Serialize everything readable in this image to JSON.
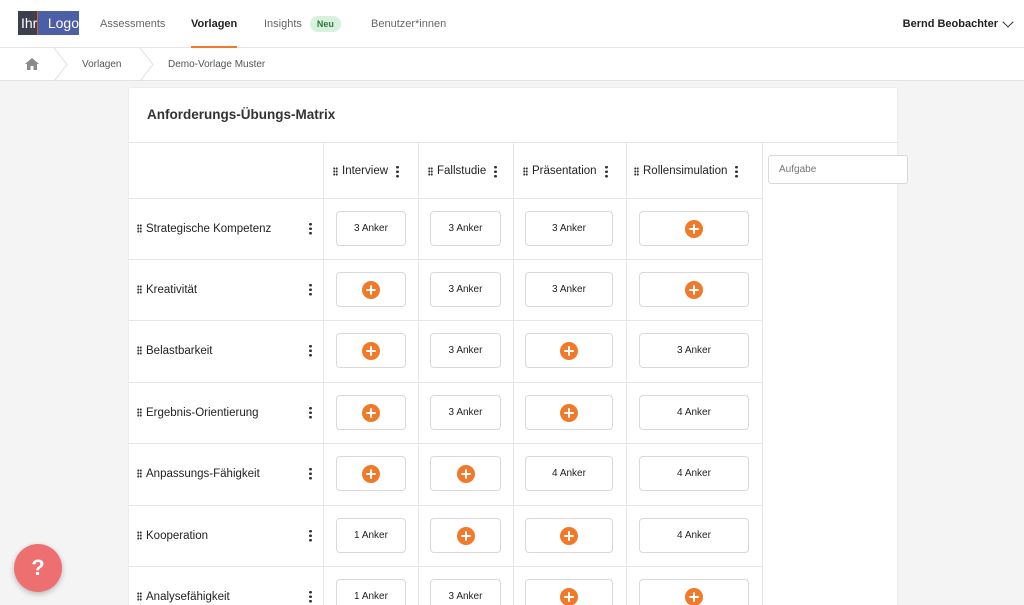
{
  "logo": {
    "left": "Ihr",
    "right": "Logo"
  },
  "nav": {
    "items": [
      {
        "label": "Assessments"
      },
      {
        "label": "Vorlagen"
      },
      {
        "label": "Insights",
        "badge": "Neu"
      },
      {
        "label": "Benutzer*innen"
      }
    ],
    "user": "Bernd Beobachter"
  },
  "breadcrumb": {
    "items": [
      "Vorlagen",
      "Demo-Vorlage Muster"
    ]
  },
  "matrix": {
    "title": "Anforderungs-Übungs-Matrix",
    "columns": [
      "Interview",
      "Fallstudie",
      "Präsentation",
      "Rollensimulation"
    ],
    "task_placeholder": "Aufgabe",
    "rows": [
      {
        "label": "Strategische Kompetenz",
        "cells": [
          "3 Anker",
          "3 Anker",
          "3 Anker",
          ""
        ]
      },
      {
        "label": "Kreativität",
        "cells": [
          "",
          "3 Anker",
          "3 Anker",
          ""
        ]
      },
      {
        "label": "Belastbarkeit",
        "cells": [
          "",
          "3 Anker",
          "",
          "3 Anker"
        ]
      },
      {
        "label": "Ergebnis-Orientierung",
        "cells": [
          "",
          "3 Anker",
          "",
          "4 Anker"
        ]
      },
      {
        "label": "Anpassungs-Fähigkeit",
        "cells": [
          "",
          "",
          "4 Anker",
          "4 Anker"
        ]
      },
      {
        "label": "Kooperation",
        "cells": [
          "1 Anker",
          "",
          "",
          "4 Anker"
        ]
      },
      {
        "label": "Analysefähigkeit",
        "cells": [
          "1 Anker",
          "3 Anker",
          "",
          ""
        ]
      }
    ]
  },
  "help": {
    "label": "?"
  },
  "colors": {
    "accent": "#f07a2a",
    "help": "#ee6f6f",
    "badge_bg": "#d7f1dd"
  }
}
